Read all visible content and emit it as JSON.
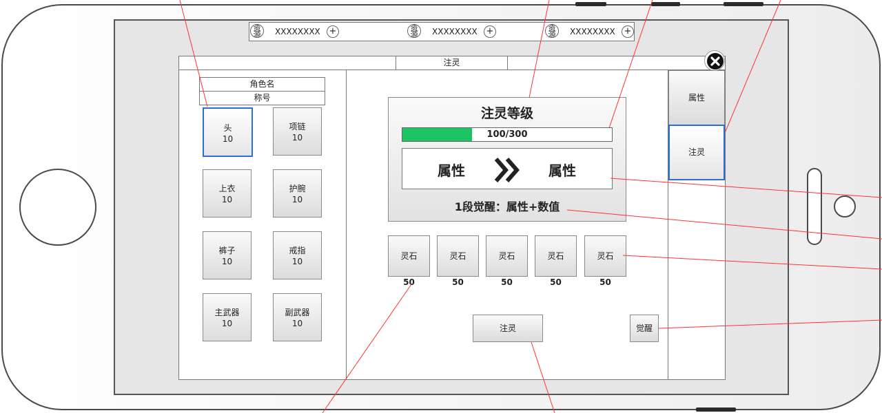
{
  "resources": [
    {
      "icon_label": "资源",
      "value": "XXXXXXXX",
      "plus": "+"
    },
    {
      "icon_label": "资源",
      "value": "XXXXXXXX",
      "plus": "+"
    },
    {
      "icon_label": "资源",
      "value": "XXXXXXXX",
      "plus": "+"
    }
  ],
  "panel": {
    "title": "注灵",
    "close_icon": "close-icon"
  },
  "character": {
    "name": "角色名",
    "title": "称号"
  },
  "equipment": [
    {
      "name": "头",
      "level": "10",
      "selected": true
    },
    {
      "name": "项链",
      "level": "10"
    },
    {
      "name": "上衣",
      "level": "10"
    },
    {
      "name": "护腕",
      "level": "10"
    },
    {
      "name": "裤子",
      "level": "10"
    },
    {
      "name": "戒指",
      "level": "10"
    },
    {
      "name": "主武器",
      "level": "10"
    },
    {
      "name": "副武器",
      "level": "10"
    }
  ],
  "inject": {
    "title": "注灵等级",
    "progress_text": "100/300",
    "progress_fraction": 0.3333,
    "progress_color": "#1dc463",
    "attr_from": "属性",
    "attr_to": "属性",
    "arrow_icon": "double-chevron-right-icon",
    "awaken_text": "1段觉醒：属性+数值"
  },
  "stones": [
    {
      "label": "灵石",
      "count": "50"
    },
    {
      "label": "灵石",
      "count": "50"
    },
    {
      "label": "灵石",
      "count": "50"
    },
    {
      "label": "灵石",
      "count": "50"
    },
    {
      "label": "灵石",
      "count": "50"
    }
  ],
  "actions": {
    "inject_label": "注灵",
    "awaken_label": "觉醒"
  },
  "side_tabs": [
    {
      "label": "属性"
    },
    {
      "label": "注灵",
      "selected": true
    }
  ],
  "colors": {
    "selection": "#2a6fd6",
    "annotation_line": "#ff3333"
  }
}
